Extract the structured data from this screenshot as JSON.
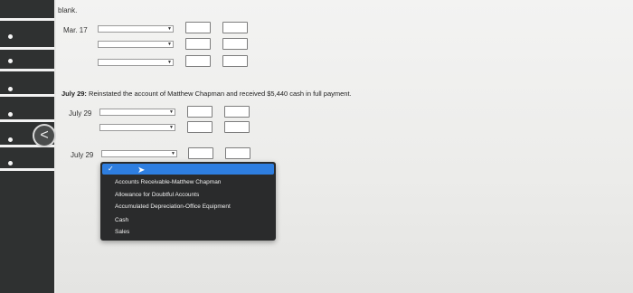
{
  "sections": {
    "blank_label": "blank.",
    "mar17": {
      "date": "Mar. 17"
    },
    "instruction": {
      "date": "July 29:",
      "text": "Reinstated the account of Matthew Chapman and received $5,440 cash in full payment."
    },
    "july29_a": {
      "date": "July 29"
    },
    "july29_b": {
      "date": "July 29"
    }
  },
  "dropdown": {
    "options": [
      "Accounts Receivable-Matthew Chapman",
      "Allowance for Doubtful Accounts",
      "Accumulated Depreciation-Office Equipment",
      "Cash",
      "Sales"
    ],
    "check": "✓"
  },
  "nav": {
    "back_glyph": "<"
  }
}
